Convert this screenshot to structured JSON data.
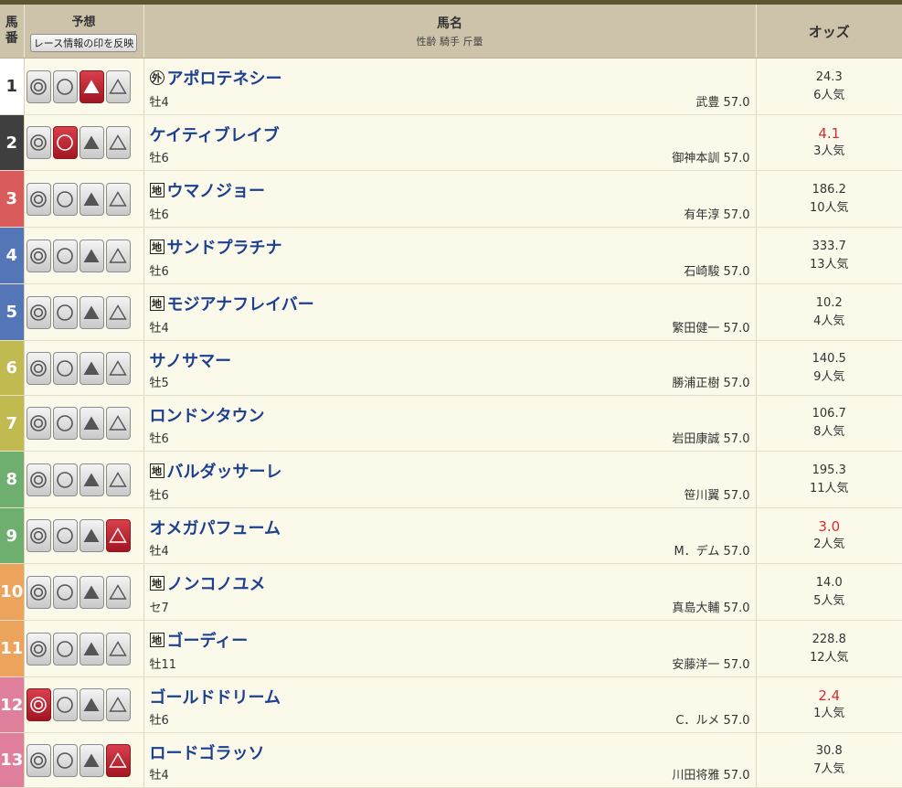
{
  "header": {
    "umaban": "馬番",
    "yoso": "予想",
    "reflect_button": "レース情報の印を反映",
    "bamei": "馬名",
    "bamei_sub": "性齢 騎手 斤量",
    "odds": "オッズ"
  },
  "colors": {
    "frame1": "#ffffff",
    "frame2": "#3f3f3f",
    "frame3": "#d95b5b",
    "frame4": "#5476b6",
    "frame5": "#c1ba51",
    "frame6": "#6eae6e",
    "frame7": "#eca45d",
    "frame8": "#df7f9c",
    "mark_on": "#b8212d",
    "horse_link": "#1d3f8f",
    "odds_hot": "#d32d2d"
  },
  "rows": [
    {
      "num": "1",
      "frame": "1",
      "badge": "外",
      "badge_type": "maru",
      "name": "アポロテネシー",
      "sexage": "牡4",
      "jockey": "武豊 57.0",
      "odds": "24.3",
      "hot": false,
      "pop": "6人気",
      "marks": [
        "off",
        "off",
        "on",
        "off"
      ]
    },
    {
      "num": "2",
      "frame": "2",
      "badge": "",
      "badge_type": "",
      "name": "ケイティブレイブ",
      "sexage": "牡6",
      "jockey": "御神本訓 57.0",
      "odds": "4.1",
      "hot": true,
      "pop": "3人気",
      "marks": [
        "off",
        "on",
        "off",
        "off"
      ]
    },
    {
      "num": "3",
      "frame": "3",
      "badge": "地",
      "badge_type": "kaku",
      "name": "ウマノジョー",
      "sexage": "牡6",
      "jockey": "有年淳 57.0",
      "odds": "186.2",
      "hot": false,
      "pop": "10人気",
      "marks": [
        "off",
        "off",
        "off",
        "off"
      ]
    },
    {
      "num": "4",
      "frame": "4",
      "badge": "地",
      "badge_type": "kaku",
      "name": "サンドプラチナ",
      "sexage": "牡6",
      "jockey": "石崎駿 57.0",
      "odds": "333.7",
      "hot": false,
      "pop": "13人気",
      "marks": [
        "off",
        "off",
        "off",
        "off"
      ]
    },
    {
      "num": "5",
      "frame": "4",
      "badge": "地",
      "badge_type": "kaku",
      "name": "モジアナフレイバー",
      "sexage": "牡4",
      "jockey": "繁田健一 57.0",
      "odds": "10.2",
      "hot": false,
      "pop": "4人気",
      "marks": [
        "off",
        "off",
        "off",
        "off"
      ]
    },
    {
      "num": "6",
      "frame": "5",
      "badge": "",
      "badge_type": "",
      "name": "サノサマー",
      "sexage": "牡5",
      "jockey": "勝浦正樹 57.0",
      "odds": "140.5",
      "hot": false,
      "pop": "9人気",
      "marks": [
        "off",
        "off",
        "off",
        "off"
      ]
    },
    {
      "num": "7",
      "frame": "5",
      "badge": "",
      "badge_type": "",
      "name": "ロンドンタウン",
      "sexage": "牡6",
      "jockey": "岩田康誠 57.0",
      "odds": "106.7",
      "hot": false,
      "pop": "8人気",
      "marks": [
        "off",
        "off",
        "off",
        "off"
      ]
    },
    {
      "num": "8",
      "frame": "6",
      "badge": "地",
      "badge_type": "kaku",
      "name": "バルダッサーレ",
      "sexage": "牡6",
      "jockey": "笹川翼 57.0",
      "odds": "195.3",
      "hot": false,
      "pop": "11人気",
      "marks": [
        "off",
        "off",
        "off",
        "off"
      ]
    },
    {
      "num": "9",
      "frame": "6",
      "badge": "",
      "badge_type": "",
      "name": "オメガパフューム",
      "sexage": "牡4",
      "jockey": "M．デム 57.0",
      "odds": "3.0",
      "hot": true,
      "pop": "2人気",
      "marks": [
        "off",
        "off",
        "off",
        "on"
      ]
    },
    {
      "num": "10",
      "frame": "7",
      "badge": "地",
      "badge_type": "kaku",
      "name": "ノンコノユメ",
      "sexage": "セ7",
      "jockey": "真島大輔 57.0",
      "odds": "14.0",
      "hot": false,
      "pop": "5人気",
      "marks": [
        "off",
        "off",
        "off",
        "off"
      ]
    },
    {
      "num": "11",
      "frame": "7",
      "badge": "地",
      "badge_type": "kaku",
      "name": "ゴーディー",
      "sexage": "牡11",
      "jockey": "安藤洋一 57.0",
      "odds": "228.8",
      "hot": false,
      "pop": "12人気",
      "marks": [
        "off",
        "off",
        "off",
        "off"
      ]
    },
    {
      "num": "12",
      "frame": "8",
      "badge": "",
      "badge_type": "",
      "name": "ゴールドドリーム",
      "sexage": "牡6",
      "jockey": "C．ルメ 57.0",
      "odds": "2.4",
      "hot": true,
      "pop": "1人気",
      "marks": [
        "on",
        "off",
        "off",
        "off"
      ]
    },
    {
      "num": "13",
      "frame": "8",
      "badge": "",
      "badge_type": "",
      "name": "ロードゴラッソ",
      "sexage": "牡4",
      "jockey": "川田将雅 57.0",
      "odds": "30.8",
      "hot": false,
      "pop": "7人気",
      "marks": [
        "off",
        "off",
        "off",
        "on"
      ]
    }
  ],
  "mark_icons": [
    "double-circle-icon",
    "circle-icon",
    "filled-triangle-icon",
    "triangle-icon"
  ]
}
